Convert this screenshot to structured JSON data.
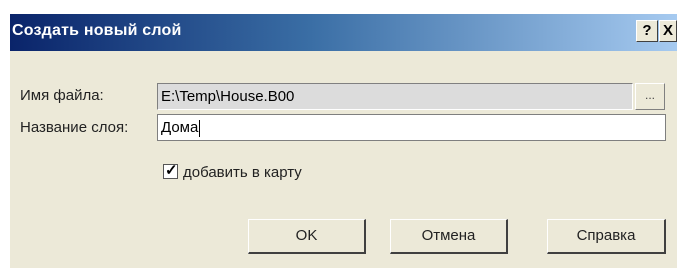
{
  "dialog": {
    "title": "Создать новый слой",
    "help_button": "?",
    "close_button": "X"
  },
  "form": {
    "file_name_label": "Имя файла:",
    "file_name_value": "E:\\Temp\\House.B00",
    "browse_button": "...",
    "layer_name_label": "Название слоя:",
    "layer_name_value": "Дома",
    "add_to_map_label": "добавить в карту",
    "add_to_map_checked": true
  },
  "buttons": {
    "ok": "OK",
    "cancel": "Отмена",
    "help": "Справка"
  }
}
